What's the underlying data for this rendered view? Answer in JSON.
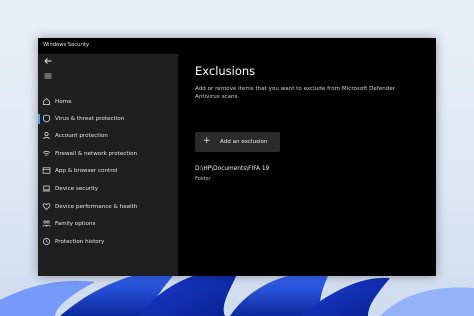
{
  "window": {
    "title": "Windows Security"
  },
  "sidebar": {
    "items": [
      {
        "label": "Home",
        "icon": "home-icon",
        "active": false
      },
      {
        "label": "Virus & threat protection",
        "icon": "shield-icon",
        "active": true
      },
      {
        "label": "Account protection",
        "icon": "person-icon",
        "active": false
      },
      {
        "label": "Firewall & network protection",
        "icon": "wifi-icon",
        "active": false
      },
      {
        "label": "App & browser control",
        "icon": "app-window-icon",
        "active": false
      },
      {
        "label": "Device security",
        "icon": "laptop-icon",
        "active": false
      },
      {
        "label": "Device performance & health",
        "icon": "heart-icon",
        "active": false
      },
      {
        "label": "Family options",
        "icon": "family-icon",
        "active": false
      },
      {
        "label": "Protection history",
        "icon": "history-icon",
        "active": false
      }
    ]
  },
  "main": {
    "heading": "Exclusions",
    "description": "Add or remove items that you want to exclude from Microsoft Defender Antivirus scans.",
    "add_button_label": "Add an exclusion",
    "exclusions": [
      {
        "path": "D:\\HP\\Documents\\FIFA 19",
        "type": "Folder"
      }
    ]
  },
  "colors": {
    "accent": "#4aa3ff",
    "sidebar_bg": "#1f1f1f",
    "content_bg": "#000000",
    "button_bg": "#2b2b2b"
  }
}
